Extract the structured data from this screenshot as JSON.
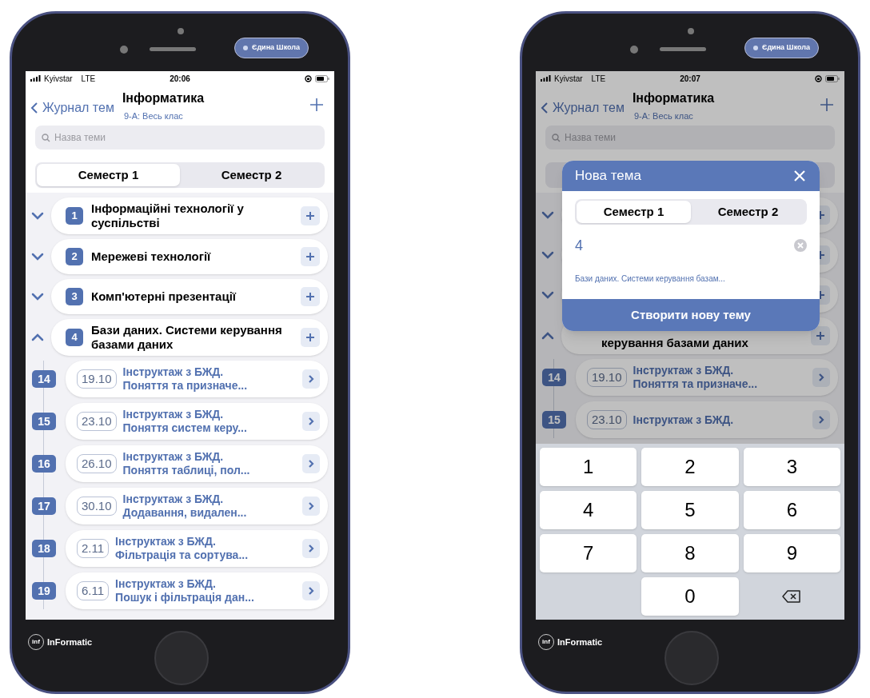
{
  "phones": [
    {
      "badge": "Єдина Школа",
      "carrier": "Kyivstar",
      "network": "LTE",
      "time": "20:06",
      "nav": {
        "back": "Журнал тем",
        "title": "Інформатика",
        "subtitle": "9-А: Весь клас"
      },
      "search": {
        "placeholder": "Назва теми"
      },
      "tabs": [
        {
          "label": "Семестр 1",
          "selected": true
        },
        {
          "label": "Семестр 2",
          "selected": false
        }
      ],
      "topics": [
        {
          "number": "1",
          "title": "Інформаційні технології у суспільстві",
          "expanded": false
        },
        {
          "number": "2",
          "title": "Мережеві технології",
          "expanded": false
        },
        {
          "number": "3",
          "title": "Комп'ютерні презентації",
          "expanded": false
        },
        {
          "number": "4",
          "title": "Бази даних. Системи керування базами даних",
          "expanded": true
        }
      ],
      "lessons": [
        {
          "number": "14",
          "date": "19.10",
          "title": "Інструктаж з БЖД.",
          "subtitle": "Поняття та призначе..."
        },
        {
          "number": "15",
          "date": "23.10",
          "title": "Інструктаж з БЖД.",
          "subtitle": "Поняття систем керу..."
        },
        {
          "number": "16",
          "date": "26.10",
          "title": "Інструктаж з БЖД.",
          "subtitle": "Поняття таблиці, пол..."
        },
        {
          "number": "17",
          "date": "30.10",
          "title": "Інструктаж з БЖД.",
          "subtitle": "Додавання, видален..."
        },
        {
          "number": "18",
          "date": "2.11",
          "title": "Інструктаж з БЖД.",
          "subtitle": "Фільтрація та сортува..."
        },
        {
          "number": "19",
          "date": "6.11",
          "title": "Інструктаж з БЖД.",
          "subtitle": "Пошук і фільтрація дан..."
        }
      ],
      "logo_mark": "inf",
      "brand": "InFormatic",
      "dimmed": false
    },
    {
      "badge": "Єдина Школа",
      "carrier": "Kyivstar",
      "network": "LTE",
      "time": "20:07",
      "nav": {
        "back": "Журнал тем",
        "title": "Інформатика",
        "subtitle": "9-А: Весь клас"
      },
      "search": {
        "placeholder": "Назва теми"
      },
      "topics": [
        {
          "expanded": false
        },
        {
          "expanded": false
        },
        {
          "expanded": false
        },
        {
          "expanded": true,
          "title_fragment": "керування базами даних"
        }
      ],
      "lessons": [
        {
          "number": "14",
          "date": "19.10",
          "title": "Інструктаж з БЖД.",
          "subtitle": "Поняття та призначе..."
        },
        {
          "number": "15",
          "date": "23.10",
          "title": "Інструктаж з БЖД."
        }
      ],
      "dialog": {
        "title": "Нова тема",
        "tabs": [
          {
            "label": "Семестр 1",
            "selected": true
          },
          {
            "label": "Семестр 2",
            "selected": false
          }
        ],
        "input_value": "4",
        "suggestion": "Бази даних. Системи керування базам...",
        "submit": "Створити нову тему"
      },
      "keyboard": [
        {
          "kind": "digit",
          "label": "1"
        },
        {
          "kind": "digit",
          "label": "2"
        },
        {
          "kind": "digit",
          "label": "3"
        },
        {
          "kind": "digit",
          "label": "4"
        },
        {
          "kind": "digit",
          "label": "5"
        },
        {
          "kind": "digit",
          "label": "6"
        },
        {
          "kind": "digit",
          "label": "7"
        },
        {
          "kind": "digit",
          "label": "8"
        },
        {
          "kind": "digit",
          "label": "9"
        },
        {
          "kind": "blank"
        },
        {
          "kind": "digit",
          "label": "0"
        },
        {
          "kind": "delete"
        }
      ],
      "logo_mark": "inf",
      "brand": "InFormatic",
      "dimmed": true
    }
  ]
}
